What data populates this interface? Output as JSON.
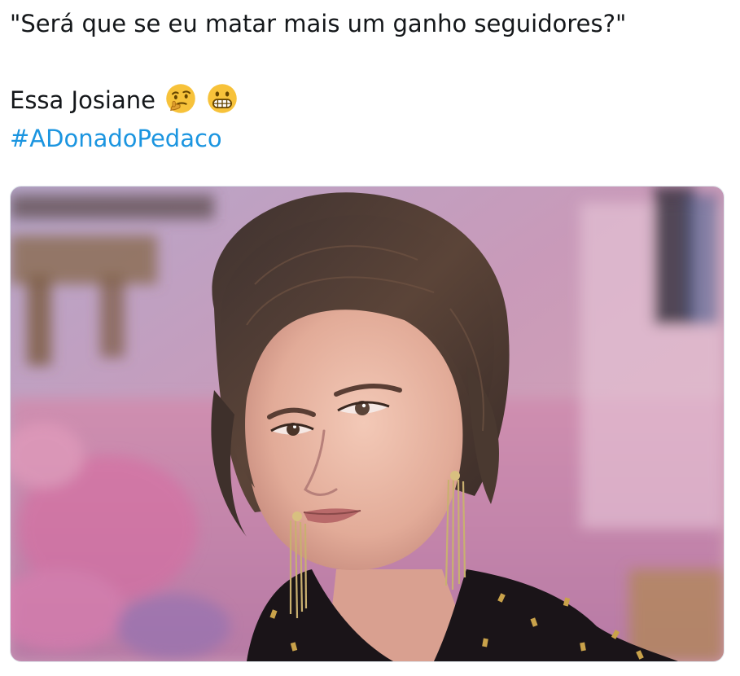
{
  "tweet": {
    "quote_line": "\"Será que se eu matar mais um ganho seguidores?\"",
    "body_line": "Essa Josiane",
    "emojis": [
      "thinking-face-icon",
      "grimacing-face-icon"
    ],
    "hashtag": "#ADonadoPedaco"
  },
  "media": {
    "alt": "Woman with short wavy brown hair and long gold fringe earrings looking sideways at the camera in a pink-lit room",
    "colors": {
      "background": "#c8a0c0",
      "hair": "#4a3a32",
      "skin": "#e8b8a8",
      "dress": "#1a1418",
      "earrings": "#c9b070"
    }
  },
  "colors": {
    "text": "#14171a",
    "link": "#1b95e0",
    "emoji_yellow": "#f7c23a"
  }
}
